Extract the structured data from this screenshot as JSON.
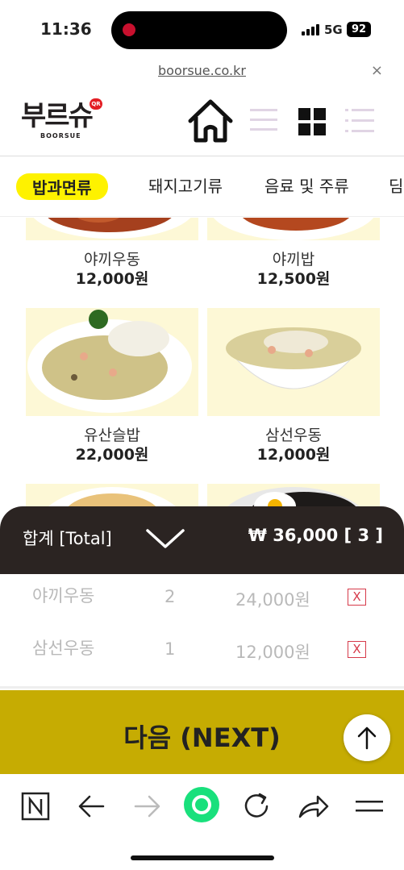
{
  "status_bar": {
    "time": "11:36",
    "network": "5G",
    "battery": "92"
  },
  "url_bar": {
    "url": "boorsue.co.kr",
    "close": "×"
  },
  "logo": {
    "text": "부르슈",
    "sub": "BOORSUE",
    "badge": "QR"
  },
  "categories": [
    {
      "label": "밥과면류",
      "active": true
    },
    {
      "label": "돼지고기류",
      "active": false
    },
    {
      "label": "음료 및 주류",
      "active": false
    },
    {
      "label": "딤",
      "active": false
    }
  ],
  "products": [
    {
      "name": "야끼우동",
      "price": "12,000원"
    },
    {
      "name": "야끼밥",
      "price": "12,500원"
    },
    {
      "name": "유산슬밥",
      "price": "22,000원"
    },
    {
      "name": "삼선우동",
      "price": "12,000원"
    }
  ],
  "total": {
    "label": "합계 [Total]",
    "amount": "₩ 36,000 [ 3 ]"
  },
  "cart": [
    {
      "name": "야끼우동",
      "qty": "2",
      "price": "24,000원",
      "remove": "X"
    },
    {
      "name": "삼선우동",
      "qty": "1",
      "price": "12,000원",
      "remove": "X"
    }
  ],
  "next_button": {
    "label": "다음 (NEXT)"
  },
  "colors": {
    "accent_yellow": "#fef200",
    "next_gold": "#c6ac02",
    "total_bar": "#2b2422",
    "remove_red": "#d63a4a",
    "browser_green": "#19e07c"
  }
}
